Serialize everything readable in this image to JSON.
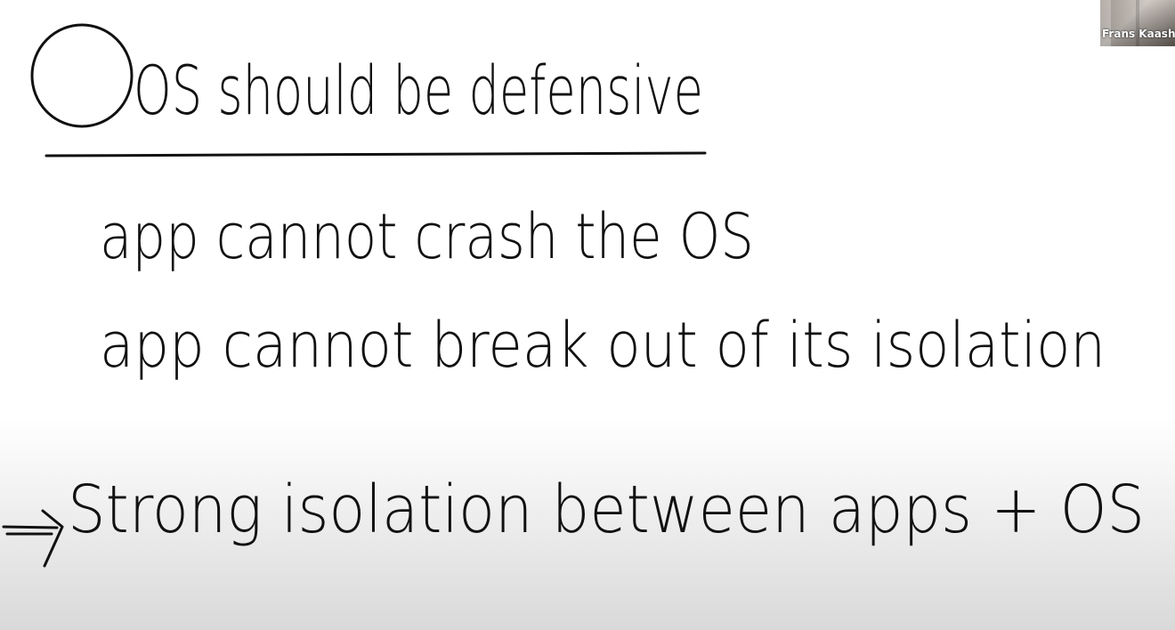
{
  "whiteboard": {
    "title_line": "OS should be defensive",
    "line1": "app cannot crash the OS",
    "line2": "app cannot break out of its isolation",
    "line3": "Strong isolation between apps + OS"
  },
  "video_tile": {
    "participant_name": "Frans Kaash"
  }
}
